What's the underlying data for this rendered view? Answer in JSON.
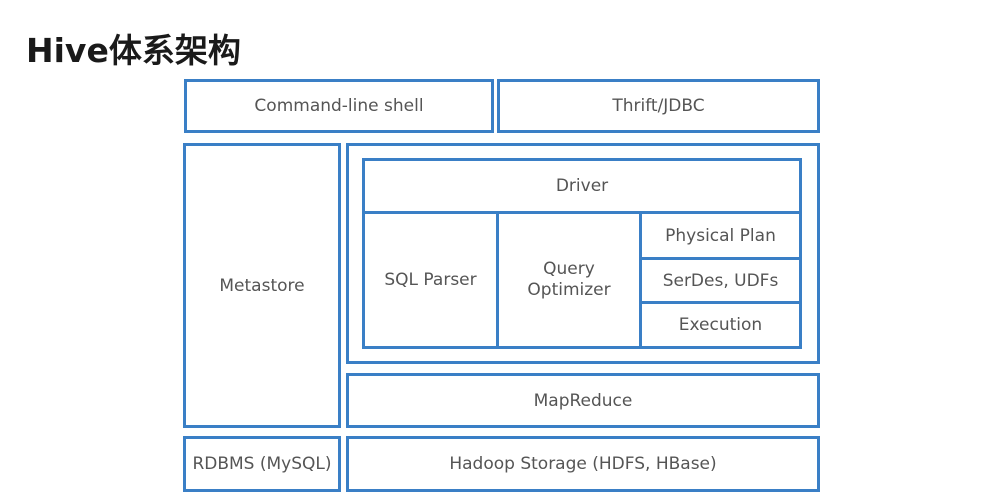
{
  "title": "Hive体系架构",
  "colors": {
    "border": "#3a7fc6",
    "text": "#555555",
    "title": "#1a1a1a"
  },
  "diagram": {
    "command_line_shell": "Command-line shell",
    "thrift_jdbc": "Thrift/JDBC",
    "metastore": "Metastore",
    "driver": "Driver",
    "sql_parser": "SQL Parser",
    "query_optimizer": "Query\nOptimizer",
    "physical_plan": "Physical Plan",
    "serdes_udfs": "SerDes, UDFs",
    "execution": "Execution",
    "mapreduce": "MapReduce",
    "rdbms": "RDBMS (MySQL)",
    "hadoop_storage": "Hadoop Storage (HDFS, HBase)"
  }
}
